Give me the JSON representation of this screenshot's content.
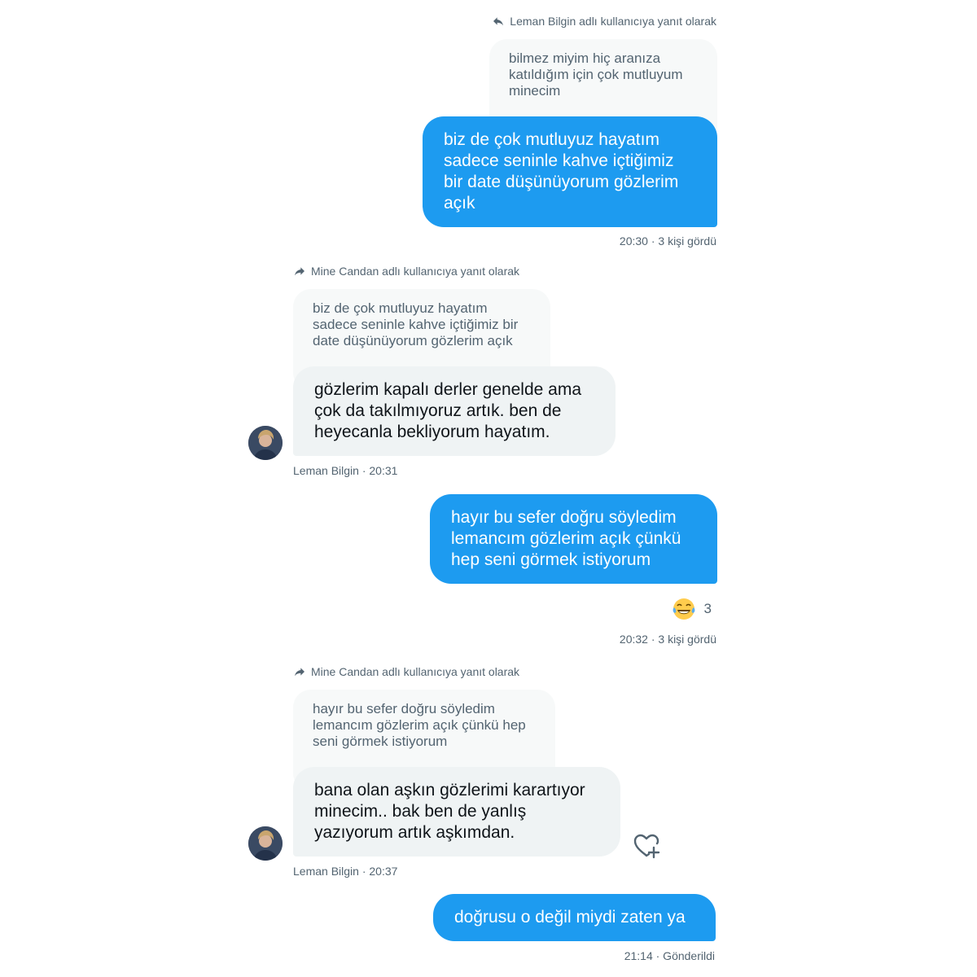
{
  "messages": [
    {
      "reply_label": "Leman Bilgin adlı kullanıcıya yanıt olarak",
      "quoted": "bilmez miyim hiç aranıza katıldığım için çok mutluyum minecim",
      "text": "biz de çok mutluyuz hayatım sadece seninle kahve içtiğimiz bir date düşünüyorum gözlerim açık",
      "meta": "20:30 · 3 kişi gördü"
    },
    {
      "reply_label": "Mine Candan adlı kullanıcıya yanıt olarak",
      "quoted": "biz de çok mutluyuz hayatım sadece seninle kahve içtiğimiz bir date düşünüyorum gözlerim açık",
      "text": "gözlerim kapalı derler genelde ama çok da takılmıyoruz artık. ben de heyecanla bekliyorum hayatım.",
      "meta": "Leman Bilgin · 20:31"
    },
    {
      "text": "hayır bu sefer doğru söyledim lemancım gözlerim açık çünkü hep seni görmek istiyorum",
      "reaction_count": "3",
      "meta": "20:32 · 3 kişi gördü"
    },
    {
      "reply_label": "Mine Candan adlı kullanıcıya yanıt olarak",
      "quoted": "hayır bu sefer doğru söyledim lemancım gözlerim açık çünkü hep seni görmek istiyorum",
      "text": "bana olan aşkın gözlerimi karartıyor minecim.. bak ben de yanlış yazıyorum artık aşkımdan.",
      "meta": "Leman Bilgin · 20:37"
    },
    {
      "text": "doğrusu o değil miydi zaten ya",
      "meta": "21:14 · Gönderildi"
    }
  ],
  "icons": {
    "reply_outgoing": "reply-arrow-icon",
    "reply_incoming": "forward-arrow-icon",
    "reaction": "laughing-tears-emoji-icon",
    "add_reaction": "heart-plus-icon",
    "avatar": "avatar-image"
  },
  "colors": {
    "outgoing_bubble": "#1d9bf0",
    "incoming_bubble": "#eff3f4",
    "quote_bubble": "#f7f9f9",
    "meta_text": "#536471"
  }
}
